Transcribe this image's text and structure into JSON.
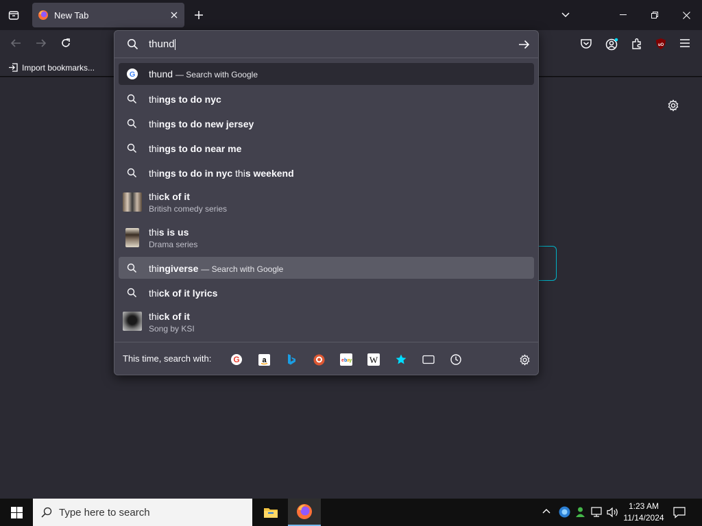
{
  "browser": {
    "tab_title": "New Tab",
    "bookmarks_import": "Import bookmarks..."
  },
  "urlbar": {
    "value": "thund",
    "results": [
      {
        "kind": "search",
        "typed": "thund",
        "rest": "",
        "action": "— Search with Google",
        "icon": "google-icon"
      },
      {
        "kind": "suggestion",
        "typed": "thi",
        "rest": "ngs to do nyc"
      },
      {
        "kind": "suggestion",
        "typed": "thi",
        "rest": "ngs to do new jersey"
      },
      {
        "kind": "suggestion",
        "typed": "thi",
        "rest": "ngs to do near me"
      },
      {
        "kind": "suggestion",
        "typed": "thi",
        "rest": "ngs to do in nyc ",
        "typed2": "thi",
        "rest2": "s weekend"
      },
      {
        "kind": "rich",
        "typed": "thi",
        "rest": "ck of it",
        "sub": "British comedy series"
      },
      {
        "kind": "rich",
        "typed": "thi",
        "rest": "s is us",
        "sub": "Drama series"
      },
      {
        "kind": "search",
        "typed": "thi",
        "rest": "ngiverse",
        "action": "— Search with Google"
      },
      {
        "kind": "suggestion",
        "typed": "thi",
        "rest": "ck of it lyrics"
      },
      {
        "kind": "rich",
        "typed": "thi",
        "rest": "ck of it",
        "sub": "Song by KSI"
      }
    ],
    "oneoff_label": "This time, search with:",
    "engines": [
      "google-icon",
      "amazon-icon",
      "bing-icon",
      "duckduckgo-icon",
      "ebay-icon",
      "wikipedia-icon",
      "bookmarks-icon",
      "tabs-icon",
      "history-icon"
    ]
  },
  "taskbar": {
    "search_placeholder": "Type here to search",
    "time": "1:23 AM",
    "date": "11/14/2024"
  },
  "colors": {
    "accent": "#00ddff",
    "panel": "#42414d",
    "ublock": "#800000"
  }
}
